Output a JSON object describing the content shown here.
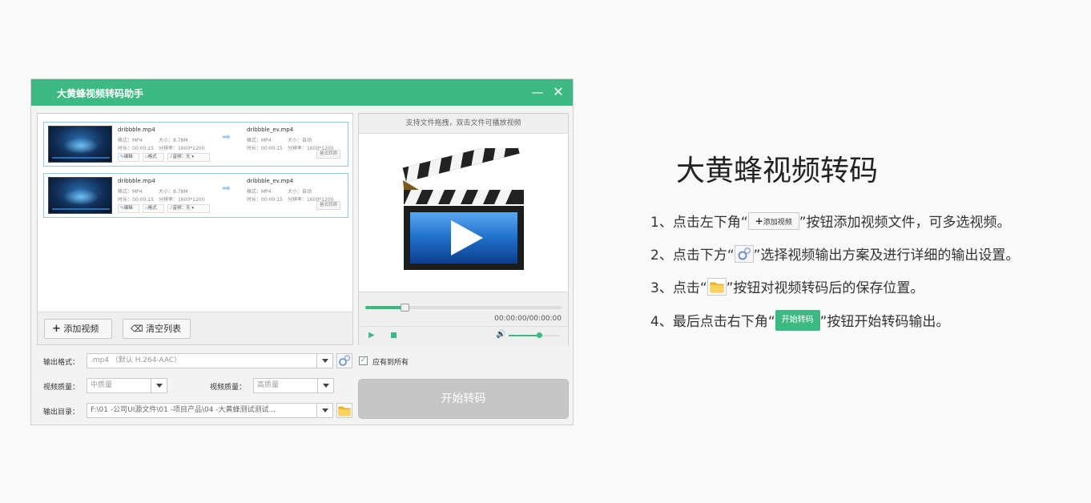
{
  "app": {
    "title": "大黄蜂视频转码助手",
    "minimize": "—",
    "close": "✕"
  },
  "files": [
    {
      "src_name": "dribbble.mp4",
      "src_format": "格式：MP4",
      "src_size": "大小：8.78M",
      "src_duration": "时长：00:00:15",
      "src_resolution": "分辨率：1600*1200",
      "dst_name": "dribbble_ev.mp4",
      "dst_format": "格式：MP4",
      "dst_size": "大小：自动",
      "dst_duration": "时长：00:00:15",
      "dst_resolution": "分辨率：1600*1200",
      "edit_label": "编辑",
      "format_label": "格式",
      "audio_label": "音频：无",
      "convert_label": "格式转换"
    },
    {
      "src_name": "dribbble.mp4",
      "src_format": "格式：MP4",
      "src_size": "大小：8.78M",
      "src_duration": "时长：00:00:15",
      "src_resolution": "分辨率：1600*1200",
      "dst_name": "dribbble_ev.mp4",
      "dst_format": "格式：MP4",
      "dst_size": "大小：自动",
      "dst_duration": "时长：00:00:15",
      "dst_resolution": "分辨率：1600*1200",
      "edit_label": "编辑",
      "format_label": "格式",
      "audio_label": "音频：无",
      "convert_label": "格式转换"
    }
  ],
  "list_toolbar": {
    "add_label": "添加视频",
    "clear_label": "清空列表"
  },
  "preview": {
    "hint": "支持文件拖拽，双击文件可播放视频",
    "time": "00:00:00/00:00:00",
    "progress": 0.2,
    "volume": 0.6
  },
  "settings": {
    "format_label": "输出格式：",
    "format_value": ".mp4 （默认 H.264-AAC）",
    "apply_all_label": "应有到所有",
    "apply_all_checked": true,
    "quality_label_1": "视频质量：",
    "quality_value_1": "中质量",
    "quality_label_2": "视频质量：",
    "quality_value_2": "高质量",
    "dir_label": "输出目录：",
    "dir_value": "F:\\01 -公司UI源文件\\01 -项目产品\\04 -大黄蜂测试测试...",
    "start_label": "开始转码"
  },
  "guide": {
    "heading": "大黄蜂视频转码",
    "step1_pre": "1、点击左下角“",
    "step1_btn": "添加视频",
    "step1_post": "”按钮添加视频文件，可多选视频。",
    "step2_pre": "2、点击下方“",
    "step2_post": "”选择视频输出方案及进行详细的输出设置。",
    "step3_pre": "3、点击“",
    "step3_post": "”按钮对视频转码后的保存位置。",
    "step4_pre": "4、最后点击右下角“",
    "step4_btn": "开始转码",
    "step4_post": "”按钮开始转码输出。"
  },
  "colors": {
    "accent": "#3dba84",
    "title_text": "#ffffff",
    "disabled_button": "#c6c6c6"
  }
}
